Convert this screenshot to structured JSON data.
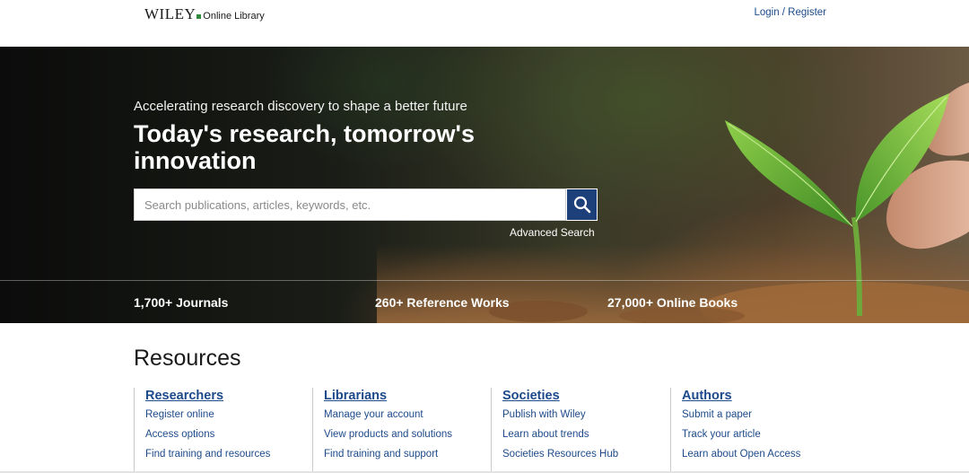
{
  "header": {
    "logo_brand": "WILEY",
    "logo_product": "Online Library",
    "login_label": "Login / Register"
  },
  "hero": {
    "tagline": "Accelerating research discovery to shape a better future",
    "headline": "Today's research, tomorrow's innovation",
    "search": {
      "placeholder": "Search publications, articles, keywords, etc.",
      "value": "",
      "button_icon": "search-icon"
    },
    "advanced_search_label": "Advanced Search",
    "stats": [
      {
        "label": "1,700+ Journals"
      },
      {
        "label": "260+ Reference Works"
      },
      {
        "label": "27,000+ Online Books"
      }
    ]
  },
  "resources": {
    "title": "Resources",
    "columns": [
      {
        "heading": "Researchers",
        "links": [
          "Register online",
          "Access options",
          "Find training and resources"
        ]
      },
      {
        "heading": "Librarians",
        "links": [
          "Manage your account",
          "View products and solutions",
          "Find training and support"
        ]
      },
      {
        "heading": "Societies",
        "links": [
          "Publish with Wiley",
          "Learn about trends",
          "Societies Resources Hub"
        ]
      },
      {
        "heading": "Authors",
        "links": [
          "Submit a paper",
          "Track your article",
          "Learn about Open Access"
        ]
      }
    ]
  },
  "colors": {
    "link_blue": "#1d4a8a",
    "search_button": "#1d3f7a",
    "logo_green": "#2f8a3a"
  }
}
